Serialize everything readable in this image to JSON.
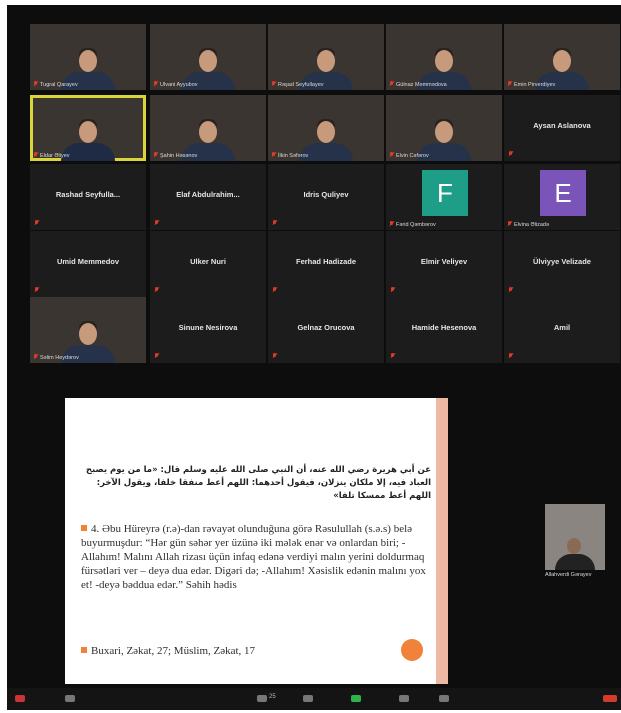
{
  "participants_row1": [
    {
      "name": "Tugral Qarayev",
      "kind": "video"
    },
    {
      "name": "Ulvani Ayyubov",
      "kind": "video"
    },
    {
      "name": "Rəşad Seyfullayev",
      "kind": "video"
    },
    {
      "name": "Gülnaz Məmmədova",
      "kind": "video"
    },
    {
      "name": "Emin Pirverdiyev",
      "kind": "video"
    }
  ],
  "participants_row2": [
    {
      "name": "Eldar Əliyev",
      "kind": "video",
      "active": true
    },
    {
      "name": "Şahin Həsənov",
      "kind": "video"
    },
    {
      "name": "İlkin Səfərov",
      "kind": "video"
    },
    {
      "name": "Elvin Cəfərov",
      "kind": "video"
    },
    {
      "name": "Aysan Aslanova",
      "kind": "name"
    }
  ],
  "participants_row3": [
    {
      "name": "Rashad Seyfulla...",
      "kind": "name"
    },
    {
      "name": "Elaf Abdulrahim...",
      "kind": "name"
    },
    {
      "name": "Idris Quliyev",
      "kind": "name"
    },
    {
      "name": "Fərid Qəmbərov",
      "kind": "avatar",
      "letter": "F",
      "color": "#1e9e86"
    },
    {
      "name": "Elvina Əlizadə",
      "kind": "avatar",
      "letter": "E",
      "color": "#7a54b8"
    }
  ],
  "participants_row4": [
    {
      "name": "Umid Memmedov",
      "kind": "name"
    },
    {
      "name": "Ulker Nuri",
      "kind": "name"
    },
    {
      "name": "Ferhad Hadizade",
      "kind": "name"
    },
    {
      "name": "Elmir Veliyev",
      "kind": "name"
    },
    {
      "name": "Ülviyye Velizade",
      "kind": "name"
    }
  ],
  "participants_row5": [
    {
      "name": "Səlim Heydərov",
      "kind": "video"
    },
    {
      "name": "Sinune Nesirova",
      "kind": "name"
    },
    {
      "name": "Gelnaz Orucova",
      "kind": "name"
    },
    {
      "name": "Hamide Hesenova",
      "kind": "name"
    },
    {
      "name": "Amil",
      "kind": "name"
    }
  ],
  "shared_slide": {
    "arabic": "عن أبي هريرة رضي الله عنه، أن النبي صلى الله عليه وسلم قال: «ما من يوم يصبح العباد فيه، إلا ملكان ينزلان، فيقول أحدهما: اللهم أعط منفقا خلفا، ويقول الآخر: اللهم أعط ممسكا تلفا»",
    "item1": "4. Əbu Hüreyrə (r.ə)-dan rəvayət olunduğuna görə Rəsulullah (s.ə.s) belə buyurmuşdur: “Hər gün səhər yer üzünə iki mələk enər və onlardan biri; - Allahım! Malını Allah rizası üçün infaq edənə verdiyi malın yerini doldurmaq fürsətləri ver – deyə dua edər. Digəri də; -Allahım! Xəsislik edənin malını yox et! -deyə bəddua edər.” Səhih hədis",
    "item2": "Buxari, Zəkat, 27; Müslim, Zəkat, 17"
  },
  "side_participant": {
    "name": "Allahverdi Gərayev"
  },
  "toolbar": {
    "participants_count": "25"
  }
}
